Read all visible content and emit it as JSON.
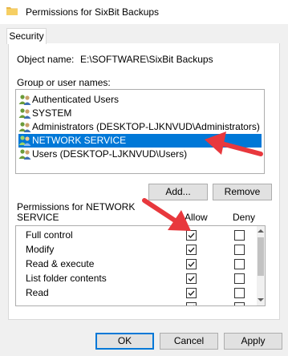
{
  "window": {
    "title": "Permissions for SixBit Backups"
  },
  "tabs": [
    {
      "label": "Security"
    }
  ],
  "object": {
    "label": "Object name:",
    "value": "E:\\SOFTWARE\\SixBit Backups"
  },
  "group_list": {
    "label": "Group or user names:",
    "items": [
      {
        "name": "Authenticated Users"
      },
      {
        "name": "SYSTEM"
      },
      {
        "name": "Administrators (DESKTOP-LJKNVUD\\Administrators)"
      },
      {
        "name": "NETWORK SERVICE",
        "selected": true
      },
      {
        "name": "Users (DESKTOP-LJKNVUD\\Users)"
      }
    ]
  },
  "group_buttons": {
    "add": "Add...",
    "remove": "Remove"
  },
  "permissions": {
    "label_line1": "Permissions for NETWORK",
    "label_line2": "SERVICE",
    "allow_header": "Allow",
    "deny_header": "Deny",
    "rows": [
      {
        "name": "Full control",
        "allow": true,
        "deny": false
      },
      {
        "name": "Modify",
        "allow": true,
        "deny": false
      },
      {
        "name": "Read & execute",
        "allow": true,
        "deny": false
      },
      {
        "name": "List folder contents",
        "allow": true,
        "deny": false
      },
      {
        "name": "Read",
        "allow": true,
        "deny": false
      }
    ]
  },
  "dialog_buttons": {
    "ok": "OK",
    "cancel": "Cancel",
    "apply": "Apply"
  },
  "colors": {
    "selection": "#0078d7",
    "annotation_arrow": "#e8383d"
  }
}
